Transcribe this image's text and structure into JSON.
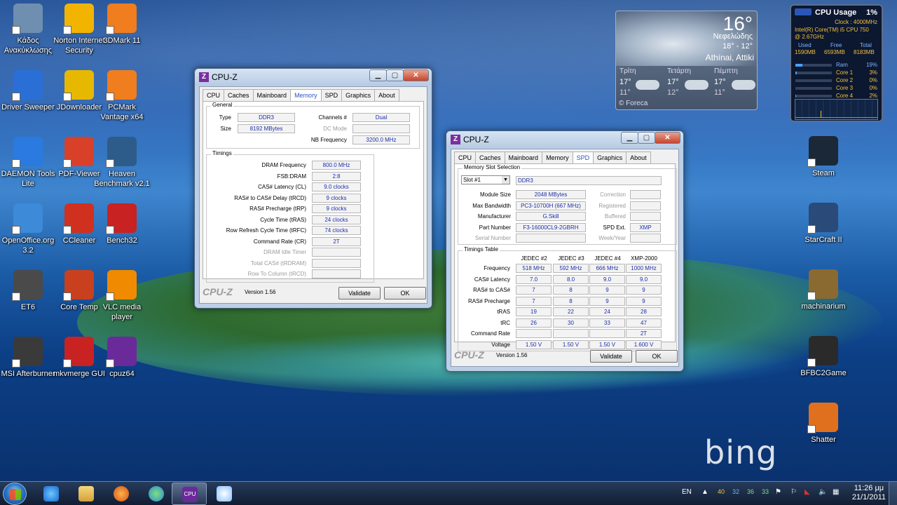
{
  "desktop": {
    "icons_left": [
      {
        "label": "Κάδος Ανακύκλωσης",
        "icon": "recycle-bin-icon",
        "color": "#6f8fb0"
      },
      {
        "label": "Norton Internet Security",
        "icon": "norton-icon",
        "color": "#f2b400"
      },
      {
        "label": "3DMark 11",
        "icon": "3dmark-icon",
        "color": "#f07d1e"
      },
      {
        "label": "Driver Sweeper",
        "icon": "driver-sweeper-icon",
        "color": "#2a6fd6"
      },
      {
        "label": "JDownloader",
        "icon": "jdownloader-icon",
        "color": "#e6b800"
      },
      {
        "label": "PCMark Vantage x64",
        "icon": "pcmark-icon",
        "color": "#f07d1e"
      },
      {
        "label": "DAEMON Tools Lite",
        "icon": "daemon-tools-icon",
        "color": "#2a7ae0"
      },
      {
        "label": "PDF-Viewer",
        "icon": "pdf-viewer-icon",
        "color": "#d8402a"
      },
      {
        "label": "Heaven Benchmark v2.1",
        "icon": "heaven-benchmark-icon",
        "color": "#2d5c8a"
      },
      {
        "label": "OpenOffice.org 3.2",
        "icon": "openoffice-icon",
        "color": "#3c8ad8"
      },
      {
        "label": "CCleaner",
        "icon": "ccleaner-icon",
        "color": "#d0301e"
      },
      {
        "label": "Bench32",
        "icon": "bench32-icon",
        "color": "#c82222"
      },
      {
        "label": "ET6",
        "icon": "et6-icon",
        "color": "#4a4a4a"
      },
      {
        "label": "Core Temp",
        "icon": "core-temp-icon",
        "color": "#c8401e"
      },
      {
        "label": "VLC media player",
        "icon": "vlc-icon",
        "color": "#f08a00"
      },
      {
        "label": "MSI Afterburner",
        "icon": "msi-afterburner-icon",
        "color": "#3a3a3a"
      },
      {
        "label": "mkvmerge GUI",
        "icon": "mkvmerge-icon",
        "color": "#c82222"
      },
      {
        "label": "cpuz64",
        "icon": "cpuz-icon",
        "color": "#6a2a9a"
      }
    ],
    "icons_right": [
      {
        "label": "Steam",
        "icon": "steam-icon",
        "color": "#1b2838"
      },
      {
        "label": "StarCraft II",
        "icon": "starcraft-icon",
        "color": "#2a4a7a"
      },
      {
        "label": "machinarium",
        "icon": "machinarium-icon",
        "color": "#8a6a30"
      },
      {
        "label": "BFBC2Game",
        "icon": "bfbc2-icon",
        "color": "#2a2a2a"
      },
      {
        "label": "Shatter",
        "icon": "shatter-icon",
        "color": "#e0701e"
      }
    ],
    "watermark": "bing"
  },
  "weather": {
    "temp": "16°",
    "condition": "Νεφελώδης",
    "range": "18° - 12°",
    "city": "Athínai, Attiki",
    "days": [
      {
        "name": "Τρίτη",
        "hi": "17°",
        "lo": "11°"
      },
      {
        "name": "Τετάρτη",
        "hi": "17°",
        "lo": "12°"
      },
      {
        "name": "Πέμπτη",
        "hi": "17°",
        "lo": "11°"
      }
    ],
    "brand": "© Foreca"
  },
  "cpu_gadget": {
    "title": "CPU Usage",
    "percent": "1%",
    "clock": "Clock : 4000MHz",
    "cpu_name": "Intel(R) Core(TM) i5 CPU 750",
    "cpu_freq": "@ 2.67GHz",
    "headers": [
      "Used",
      "Free",
      "Total"
    ],
    "mem": [
      "1590MB",
      "6593MB",
      "8183MB"
    ],
    "bars": [
      {
        "label": "Ram",
        "value": "19%",
        "fill": 0.19
      },
      {
        "label": "Core 1",
        "value": "3%",
        "fill": 0.03
      },
      {
        "label": "Core 2",
        "value": "0%",
        "fill": 0.0
      },
      {
        "label": "Core 3",
        "value": "0%",
        "fill": 0.0
      },
      {
        "label": "Core 4",
        "value": "2%",
        "fill": 0.02
      }
    ]
  },
  "cpuz_memory": {
    "title": "CPU-Z",
    "tabs": [
      "CPU",
      "Caches",
      "Mainboard",
      "Memory",
      "SPD",
      "Graphics",
      "About"
    ],
    "active_tab": "Memory",
    "general_label": "General",
    "type_label": "Type",
    "type": "DDR3",
    "size_label": "Size",
    "size": "8192 MBytes",
    "channels_label": "Channels #",
    "channels": "Dual",
    "dcmode_label": "DC Mode",
    "dcmode": "",
    "nbfreq_label": "NB Frequency",
    "nbfreq": "3200.0 MHz",
    "timings_label": "Timings",
    "timings": [
      {
        "label": "DRAM Frequency",
        "value": "800.0 MHz",
        "dim": false
      },
      {
        "label": "FSB:DRAM",
        "value": "2:8",
        "dim": false
      },
      {
        "label": "CAS# Latency (CL)",
        "value": "9.0 clocks",
        "dim": false
      },
      {
        "label": "RAS# to CAS# Delay (tRCD)",
        "value": "9 clocks",
        "dim": false
      },
      {
        "label": "RAS# Precharge (tRP)",
        "value": "9 clocks",
        "dim": false
      },
      {
        "label": "Cycle Time (tRAS)",
        "value": "24 clocks",
        "dim": false
      },
      {
        "label": "Row Refresh Cycle Time (tRFC)",
        "value": "74 clocks",
        "dim": false
      },
      {
        "label": "Command Rate (CR)",
        "value": "2T",
        "dim": false
      },
      {
        "label": "DRAM Idle Timer",
        "value": "",
        "dim": true
      },
      {
        "label": "Total CAS# (tRDRAM)",
        "value": "",
        "dim": true
      },
      {
        "label": "Row To Column (tRCD)",
        "value": "",
        "dim": true
      }
    ],
    "brand": "CPU-Z",
    "version": "Version 1.56",
    "validate": "Validate",
    "ok": "OK"
  },
  "cpuz_spd": {
    "title": "CPU-Z",
    "tabs": [
      "CPU",
      "Caches",
      "Mainboard",
      "Memory",
      "SPD",
      "Graphics",
      "About"
    ],
    "active_tab": "SPD",
    "slot_group": "Memory Slot Selection",
    "slot": "Slot #1",
    "slot_type": "DDR3",
    "left_rows": [
      {
        "label": "Module Size",
        "value": "2048 MBytes",
        "dim": false
      },
      {
        "label": "Max Bandwidth",
        "value": "PC3-10700H (667 MHz)",
        "dim": false
      },
      {
        "label": "Manufacturer",
        "value": "G.Skill",
        "dim": false
      },
      {
        "label": "Part Number",
        "value": "F3-16000CL9-2GBRH",
        "dim": false
      },
      {
        "label": "Serial Number",
        "value": "",
        "dim": true
      }
    ],
    "right_rows": [
      {
        "label": "Correction",
        "value": "",
        "dim": true
      },
      {
        "label": "Registered",
        "value": "",
        "dim": true
      },
      {
        "label": "Buffered",
        "value": "",
        "dim": true
      },
      {
        "label": "SPD Ext.",
        "value": "XMP",
        "dim": false
      },
      {
        "label": "Week/Year",
        "value": "",
        "dim": true
      }
    ],
    "timings_group": "Timings Table",
    "columns": [
      "JEDEC #2",
      "JEDEC #3",
      "JEDEC #4",
      "XMP-2000"
    ],
    "rows": [
      {
        "label": "Frequency",
        "values": [
          "518 MHz",
          "592 MHz",
          "666 MHz",
          "1000 MHz"
        ]
      },
      {
        "label": "CAS# Latency",
        "values": [
          "7.0",
          "8.0",
          "9.0",
          "9.0"
        ]
      },
      {
        "label": "RAS# to CAS#",
        "values": [
          "7",
          "8",
          "9",
          "9"
        ]
      },
      {
        "label": "RAS# Precharge",
        "values": [
          "7",
          "8",
          "9",
          "9"
        ]
      },
      {
        "label": "tRAS",
        "values": [
          "19",
          "22",
          "24",
          "28"
        ]
      },
      {
        "label": "tRC",
        "values": [
          "26",
          "30",
          "33",
          "47"
        ]
      },
      {
        "label": "Command Rate",
        "values": [
          "",
          "",
          "",
          "2T"
        ]
      },
      {
        "label": "Voltage",
        "values": [
          "1.50 V",
          "1.50 V",
          "1.50 V",
          "1.600 V"
        ]
      }
    ],
    "brand": "CPU-Z",
    "version": "Version 1.56",
    "validate": "Validate",
    "ok": "OK"
  },
  "taskbar": {
    "language": "EN",
    "temps": [
      {
        "value": "40",
        "color": "#f2c23a"
      },
      {
        "value": "32",
        "color": "#6fb0ff"
      },
      {
        "value": "36",
        "color": "#7fe07f"
      },
      {
        "value": "33",
        "color": "#7fe07f"
      }
    ],
    "time": "11:26 μμ",
    "date": "21/1/2011"
  }
}
